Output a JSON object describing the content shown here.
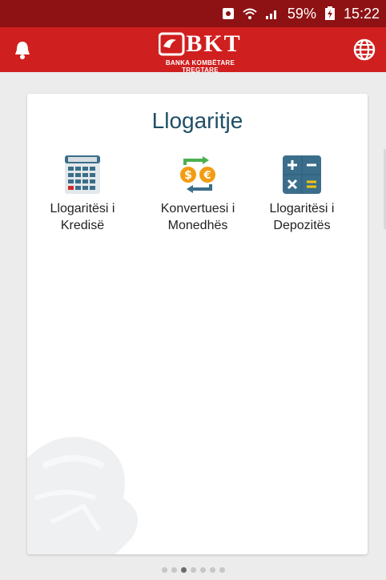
{
  "status_bar": {
    "battery": "59%",
    "time": "15:22",
    "icons": [
      "notification-badge-icon",
      "wifi-icon",
      "signal-icon",
      "battery-icon"
    ]
  },
  "app_bar": {
    "logo_text": "BKT",
    "logo_tagline": "BANKA KOMBËTARE TREGTARE",
    "left_icon": "bell-icon",
    "right_icon": "globe-icon"
  },
  "card": {
    "title": "Llogaritje",
    "tiles": [
      {
        "line1": "Llogaritësi i",
        "line2": "Kredisë",
        "icon": "calculator-icon"
      },
      {
        "line1": "Konvertuesi i",
        "line2": "Monedhës",
        "icon": "currency-exchange-icon"
      },
      {
        "line1": "Llogaritësi i",
        "line2": "Depozitës",
        "icon": "math-operators-icon"
      }
    ]
  },
  "pager": {
    "count": 7,
    "active_index": 2
  },
  "colors": {
    "status_bar": "#8e1214",
    "app_bar": "#d01f1f",
    "title": "#1f4f66",
    "background": "#ececec"
  }
}
